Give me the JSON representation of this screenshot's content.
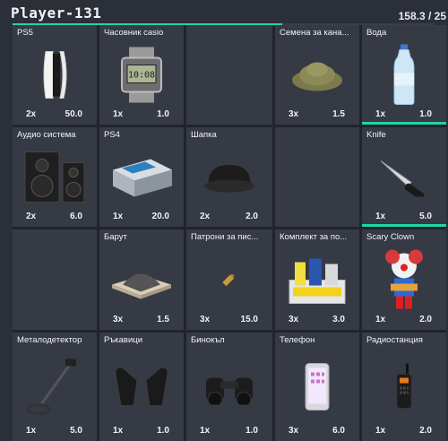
{
  "player": {
    "name": "Player-131",
    "weight_text": "158.3 / 25",
    "weight_fraction": 0.64
  },
  "accent": "#1fd6a7",
  "items": [
    {
      "name": "PS5",
      "qty": "2x",
      "weight": "50.0",
      "icon": "console-icon"
    },
    {
      "name": "Часовник casio",
      "qty": "1x",
      "weight": "1.0",
      "icon": "watch-icon"
    },
    {
      "name": "",
      "qty": "",
      "weight": "",
      "icon": ""
    },
    {
      "name": "Семена за кана...",
      "qty": "3x",
      "weight": "1.5",
      "icon": "seeds-icon"
    },
    {
      "name": "Вода",
      "qty": "1x",
      "weight": "1.0",
      "icon": "water-bottle-icon"
    },
    {
      "name": "Аудио система",
      "qty": "2x",
      "weight": "6.0",
      "icon": "speakers-icon"
    },
    {
      "name": "PS4",
      "qty": "1x",
      "weight": "20.0",
      "icon": "console-box-icon"
    },
    {
      "name": "Шапка",
      "qty": "2x",
      "weight": "2.0",
      "icon": "cap-icon"
    },
    {
      "name": "",
      "qty": "",
      "weight": "",
      "icon": ""
    },
    {
      "name": "Knife",
      "qty": "1x",
      "weight": "5.0",
      "icon": "knife-icon"
    },
    {
      "name": "",
      "qty": "",
      "weight": "",
      "icon": ""
    },
    {
      "name": "Барут",
      "qty": "3x",
      "weight": "1.5",
      "icon": "gunpowder-icon"
    },
    {
      "name": "Патрони за пис...",
      "qty": "3x",
      "weight": "15.0",
      "icon": "bullet-icon"
    },
    {
      "name": "Комплект за по...",
      "qty": "3x",
      "weight": "3.0",
      "icon": "cleaning-kit-icon"
    },
    {
      "name": "Scary Clown",
      "qty": "1x",
      "weight": "2.0",
      "icon": "clown-icon"
    },
    {
      "name": "Металодетектор",
      "qty": "1x",
      "weight": "5.0",
      "icon": "metal-detector-icon"
    },
    {
      "name": "Ръкавици",
      "qty": "1x",
      "weight": "1.0",
      "icon": "gloves-icon"
    },
    {
      "name": "Бинокъл",
      "qty": "1x",
      "weight": "1.0",
      "icon": "binoculars-icon"
    },
    {
      "name": "Телефон",
      "qty": "3x",
      "weight": "6.0",
      "icon": "phone-icon"
    },
    {
      "name": "Радиостанция",
      "qty": "1x",
      "weight": "2.0",
      "icon": "radio-icon"
    }
  ]
}
